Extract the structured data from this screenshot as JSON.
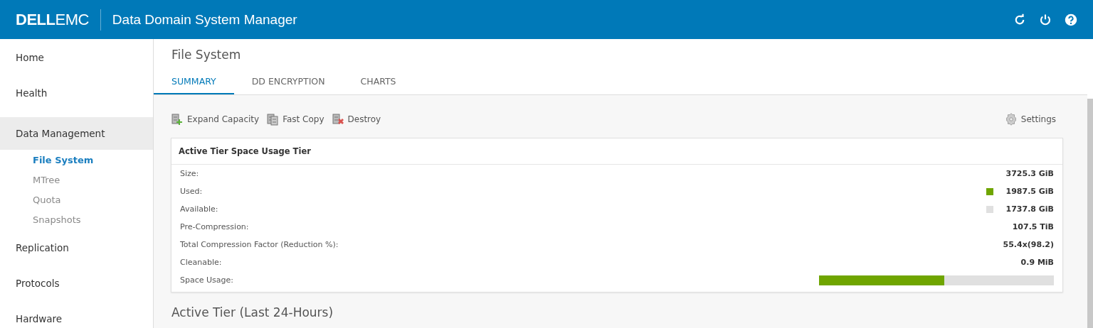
{
  "header": {
    "logo": "**DELL**EMC",
    "title": "Data Domain System Manager"
  },
  "sidebar": {
    "items": [
      {
        "label": "Home",
        "selected": false
      },
      {
        "label": "Health",
        "selected": false
      },
      {
        "label": "Data Management",
        "selected": true,
        "children": [
          {
            "label": "File System",
            "selected": true
          },
          {
            "label": "MTree",
            "selected": false
          },
          {
            "label": "Quota",
            "selected": false
          },
          {
            "label": "Snapshots",
            "selected": false
          }
        ]
      },
      {
        "label": "Replication",
        "selected": false
      },
      {
        "label": "Protocols",
        "selected": false
      },
      {
        "label": "Hardware",
        "selected": false
      }
    ]
  },
  "page": {
    "title": "File System",
    "tabs": [
      {
        "label": "SUMMARY",
        "selected": true
      },
      {
        "label": "DD ENCRYPTION",
        "selected": false
      },
      {
        "label": "CHARTS",
        "selected": false
      }
    ],
    "toolbar": [
      {
        "label": "Expand Capacity",
        "kind": "expand"
      },
      {
        "label": "Fast Copy",
        "kind": "copy"
      },
      {
        "label": "Destroy",
        "kind": "destroy"
      }
    ],
    "settings": "Settings",
    "card": {
      "title": "Active Tier Space Usage Tier",
      "rows": [
        {
          "label": "Size:",
          "kind": "text",
          "value": "3725.3 GiB"
        },
        {
          "label": "Used:",
          "kind": "legend",
          "value": "1987.5 GiB",
          "color": "#6fa500"
        },
        {
          "label": "Available:",
          "kind": "legend",
          "value": "1737.8 GiB",
          "color": "#e0e0e0"
        },
        {
          "label": "Pre-Compression:",
          "kind": "text",
          "value": "107.5 TiB"
        },
        {
          "label": "Total Compression Factor (Reduction %):",
          "kind": "text",
          "value": "55.4x(98.2)"
        },
        {
          "label": "Cleanable:",
          "kind": "text",
          "value": "0.9 MiB"
        },
        {
          "label": "Space Usage:",
          "kind": "bar",
          "level": 0.533
        }
      ]
    },
    "section_title": "Active Tier (Last 24-Hours)"
  }
}
